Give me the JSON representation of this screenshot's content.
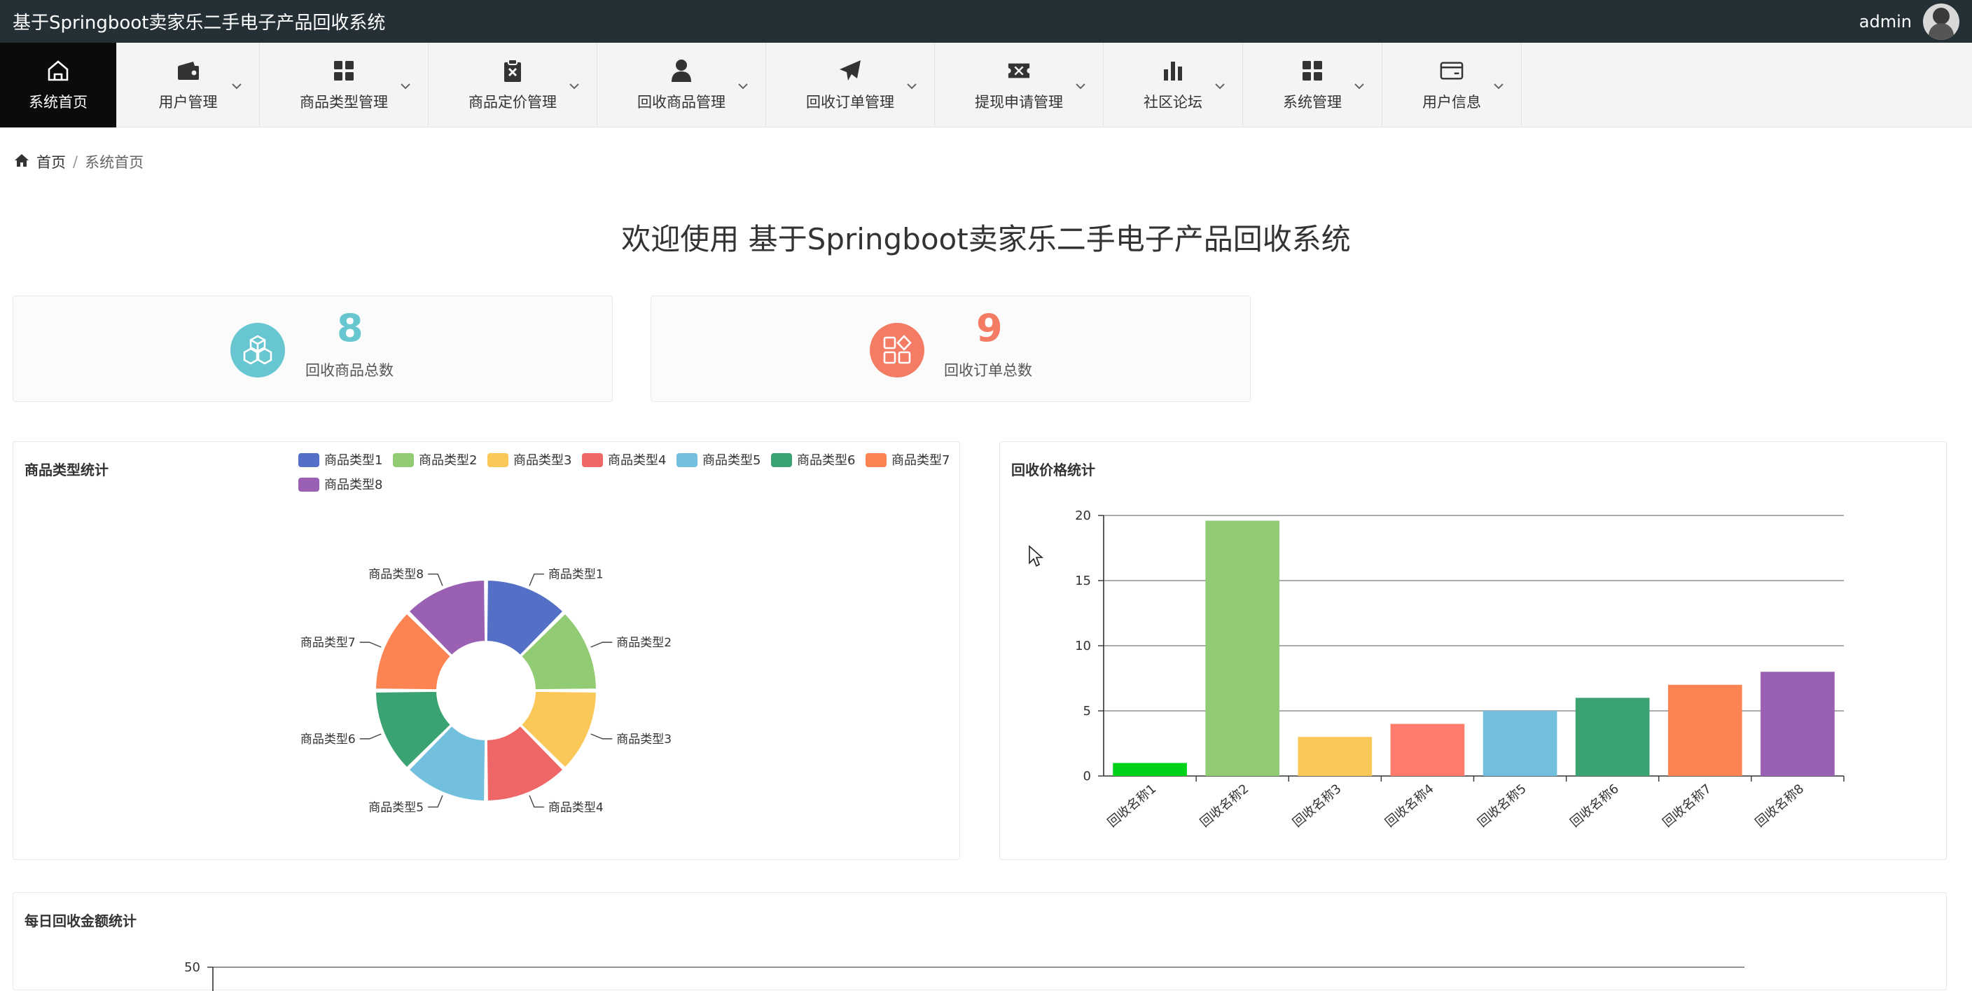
{
  "app": {
    "title": "基于Springboot卖家乐二手电子产品回收系统"
  },
  "user": {
    "name": "admin"
  },
  "nav": [
    {
      "label": "系统首页",
      "icon": "home-icon",
      "active": true
    },
    {
      "label": "用户管理",
      "icon": "wallet-icon"
    },
    {
      "label": "商品类型管理",
      "icon": "grid-icon"
    },
    {
      "label": "商品定价管理",
      "icon": "clipboard-x-icon"
    },
    {
      "label": "回收商品管理",
      "icon": "person-icon"
    },
    {
      "label": "回收订单管理",
      "icon": "paper-plane-icon"
    },
    {
      "label": "提现申请管理",
      "icon": "ticket-icon"
    },
    {
      "label": "社区论坛",
      "icon": "bar-chart-icon"
    },
    {
      "label": "系统管理",
      "icon": "grid-icon"
    },
    {
      "label": "用户信息",
      "icon": "card-icon"
    }
  ],
  "breadcrumb": {
    "home": "首页",
    "separator": "/",
    "current": "系统首页"
  },
  "welcome": "欢迎使用 基于Springboot卖家乐二手电子产品回收系统",
  "stats": [
    {
      "value": "8",
      "label": "回收商品总数",
      "color": "#67c6d0",
      "icon": "cubes-icon"
    },
    {
      "value": "9",
      "label": "回收订单总数",
      "color": "#f47c64",
      "icon": "apps-icon"
    }
  ],
  "panels": {
    "pie_title": "商品类型统计",
    "bar_title": "回收价格统计",
    "daily_title": "每日回收金额统计"
  },
  "chart_data": [
    {
      "type": "pie",
      "title": "商品类型统计",
      "categories": [
        "商品类型1",
        "商品类型2",
        "商品类型3",
        "商品类型4",
        "商品类型5",
        "商品类型6",
        "商品类型7",
        "商品类型8"
      ],
      "values": [
        1,
        1,
        1,
        1,
        1,
        1,
        1,
        1
      ],
      "colors": [
        "#5470c6",
        "#91cc75",
        "#fac858",
        "#ee6666",
        "#73c0de",
        "#3ba272",
        "#fc8452",
        "#9a60b4"
      ],
      "legend": "top"
    },
    {
      "type": "bar",
      "title": "回收价格统计",
      "categories": [
        "回收名称1",
        "回收名称2",
        "回收名称3",
        "回收名称4",
        "回收名称5",
        "回收名称6",
        "回收名称7",
        "回收名称8"
      ],
      "values": [
        1,
        19.6,
        3,
        4,
        5,
        6,
        7,
        8
      ],
      "colors": [
        "#00d21a",
        "#91cc75",
        "#fac858",
        "#ff7b6b",
        "#73c0de",
        "#3ba272",
        "#fc8452",
        "#9a60b4"
      ],
      "ylim": [
        0,
        20
      ],
      "yticks": [
        0,
        5,
        10,
        15,
        20
      ],
      "grid": true
    },
    {
      "type": "line",
      "title": "每日回收金额统计",
      "yticks": [
        50
      ]
    }
  ]
}
